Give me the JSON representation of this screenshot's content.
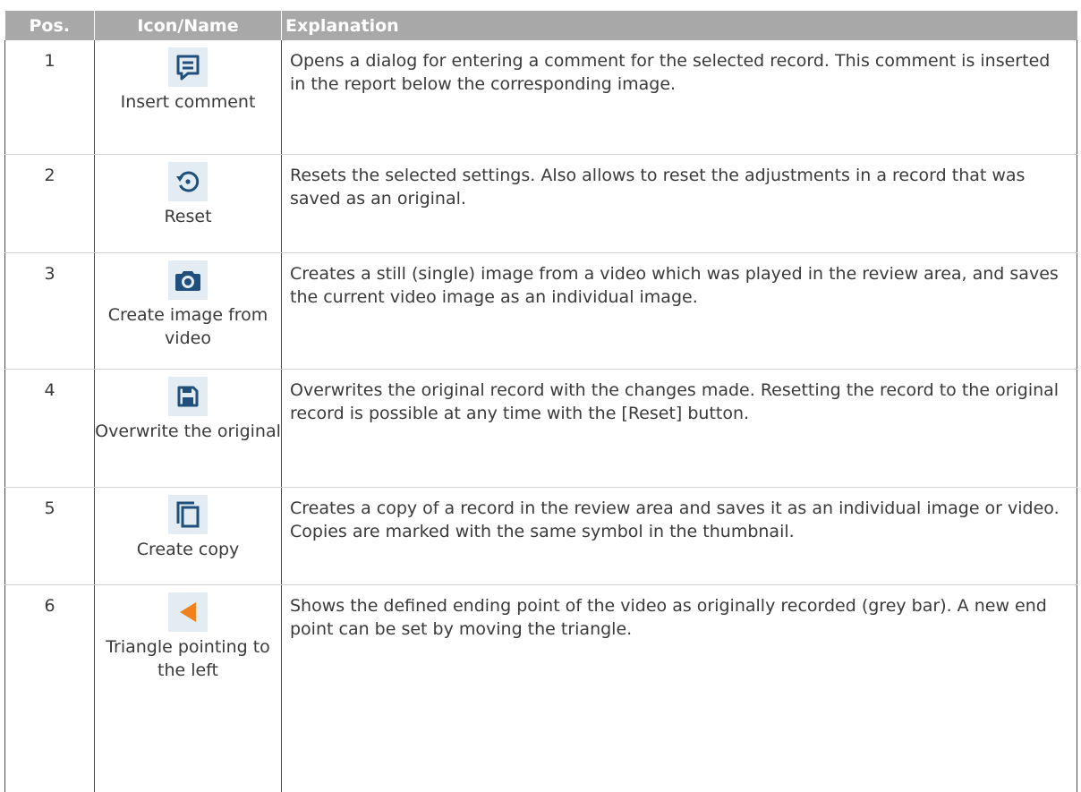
{
  "table": {
    "headers": {
      "pos": "Pos.",
      "icon": "Icon/Name",
      "explanation": "Explanation"
    },
    "rows": [
      {
        "pos": "1",
        "icon": "comment-icon",
        "name": "Insert comment",
        "explanation": "Opens a dialog for entering a comment for the selected record. This comment is inserted in the report below the corresponding image."
      },
      {
        "pos": "2",
        "icon": "reset-icon",
        "name": "Reset",
        "explanation": "Resets the selected settings. Also allows to reset the adjustments in a record that was saved as an original."
      },
      {
        "pos": "3",
        "icon": "camera-icon",
        "name": "Create image from video",
        "explanation": "Creates a still (single) image from a video which was played in the review area, and saves the current video image as an individual image."
      },
      {
        "pos": "4",
        "icon": "save-icon",
        "name": "Overwrite the original",
        "explanation": "Overwrites the original record with the changes made. Resetting the record to the original record is possible at any time with the [Reset] button."
      },
      {
        "pos": "5",
        "icon": "copy-icon",
        "name": "Create copy",
        "explanation": "Creates a copy of a record in the review area and saves it as an individual image or video. Copies are marked with the same symbol in the thumbnail."
      },
      {
        "pos": "6",
        "icon": "triangle-left-icon",
        "name": "Triangle pointing to the left",
        "explanation": "Shows the defined ending point of the video as originally recorded (grey bar). A new end point can be set by moving the triangle."
      }
    ]
  },
  "colors": {
    "header_bg": "#a8a8a8",
    "icon_blue": "#1f4f7a",
    "icon_bg": "#e3ecf3",
    "triangle_orange": "#f0821e"
  }
}
